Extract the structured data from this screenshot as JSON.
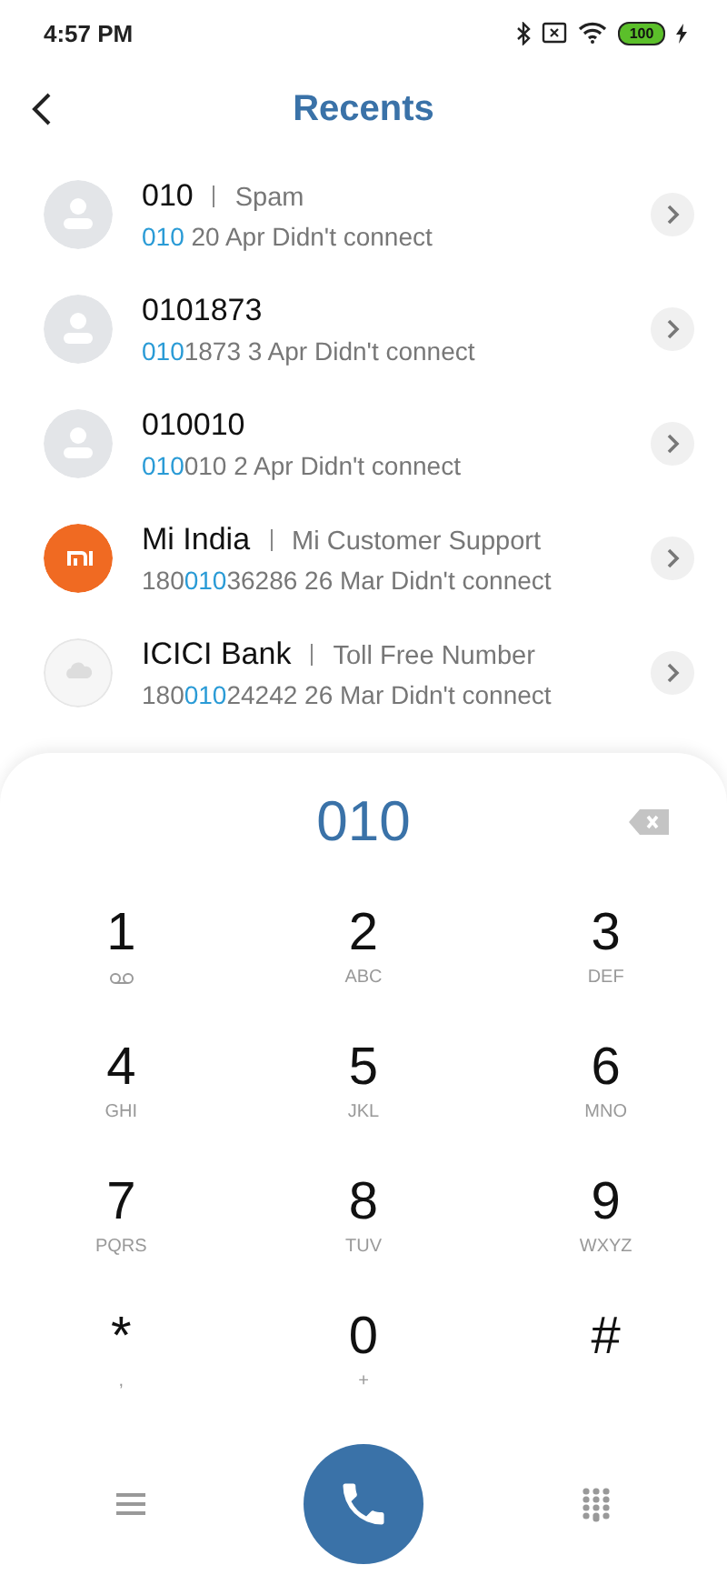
{
  "status_bar": {
    "time": "4:57 PM",
    "battery": "100"
  },
  "header": {
    "title": "Recents"
  },
  "calls": [
    {
      "kind": "person",
      "name": "010",
      "tag": "Spam",
      "number": {
        "match": "010"
      },
      "detail": "20 Apr Didn't connect"
    },
    {
      "kind": "person",
      "name": "0101873",
      "number": {
        "match": "010",
        "after": "1873"
      },
      "detail": "3 Apr Didn't connect"
    },
    {
      "kind": "person",
      "name": "010010",
      "number": {
        "match": "010",
        "after": "010"
      },
      "detail": "2 Apr Didn't connect"
    },
    {
      "kind": "mi",
      "name": "Mi India",
      "tag": "Mi Customer Support",
      "number": {
        "before": "180",
        "match": "010",
        "after": "36286"
      },
      "detail": "26 Mar Didn't connect"
    },
    {
      "kind": "cloud",
      "name": "ICICI Bank",
      "tag": "Toll Free Number",
      "number": {
        "before": "180",
        "match": "010",
        "after": "24242"
      },
      "detail": "26 Mar Didn't connect"
    }
  ],
  "dialpad": {
    "entered": "010",
    "keys": [
      {
        "digit": "1",
        "kind": "voicemail"
      },
      {
        "digit": "2",
        "letters": "ABC"
      },
      {
        "digit": "3",
        "letters": "DEF"
      },
      {
        "digit": "4",
        "letters": "GHI"
      },
      {
        "digit": "5",
        "letters": "JKL"
      },
      {
        "digit": "6",
        "letters": "MNO"
      },
      {
        "digit": "7",
        "letters": "PQRS"
      },
      {
        "digit": "8",
        "letters": "TUV"
      },
      {
        "digit": "9",
        "letters": "WXYZ"
      },
      {
        "digit": "*",
        "letters": ","
      },
      {
        "digit": "0",
        "letters": "+"
      },
      {
        "digit": "#"
      }
    ]
  }
}
